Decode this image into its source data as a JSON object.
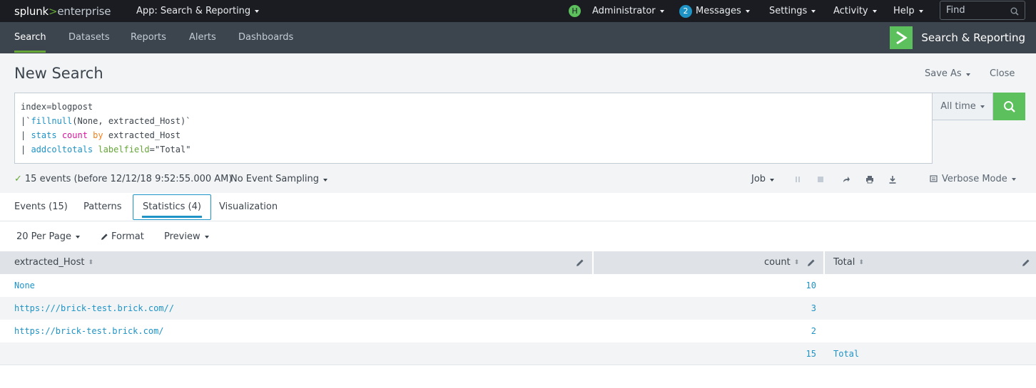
{
  "topbar": {
    "logo": {
      "brand": "splunk",
      "gt": ">",
      "product": "enterprise"
    },
    "app_menu": "App: Search & Reporting",
    "user": {
      "initial": "H",
      "name": "Administrator"
    },
    "messages": {
      "count": "2",
      "label": "Messages"
    },
    "settings": "Settings",
    "activity": "Activity",
    "help": "Help",
    "find": {
      "placeholder": "Find",
      "value": ""
    }
  },
  "appbar": {
    "nav": [
      "Search",
      "Datasets",
      "Reports",
      "Alerts",
      "Dashboards"
    ],
    "active": "Search",
    "app_title": "Search & Reporting"
  },
  "search": {
    "title": "New Search",
    "save_as": "Save As",
    "close": "Close",
    "query_lines": [
      "index=blogpost",
      "|`fillnull(None, extracted_Host)`",
      "| stats count by extracted_Host",
      "| addcoltotals labelfield=\"Total\""
    ],
    "time_range": "All time",
    "status": "15 events (before 12/12/18 9:52:55.000 AM)",
    "sampling": "No Event Sampling",
    "job": "Job",
    "mode": "Verbose Mode"
  },
  "result_tabs": {
    "events": "Events (15)",
    "patterns": "Patterns",
    "statistics": "Statistics (4)",
    "visualization": "Visualization",
    "active": "Statistics (4)"
  },
  "table_controls": {
    "per_page": "20 Per Page",
    "format": "Format",
    "preview": "Preview"
  },
  "stats_table": {
    "columns": [
      "extracted_Host",
      "count",
      "Total"
    ],
    "rows": [
      {
        "extracted_Host": "None",
        "count": "10",
        "Total": ""
      },
      {
        "extracted_Host": "https:///brick-test.brick.com//",
        "count": "3",
        "Total": ""
      },
      {
        "extracted_Host": "https://brick-test.brick.com/",
        "count": "2",
        "Total": ""
      },
      {
        "extracted_Host": "",
        "count": "15",
        "Total": "Total"
      }
    ]
  },
  "colors": {
    "topbar_bg": "#1a1c21",
    "appbar_bg": "#3c444d",
    "accent_green": "#5cc05c",
    "link_blue": "#1e93c6",
    "search_bg": "#f2f4f5"
  }
}
